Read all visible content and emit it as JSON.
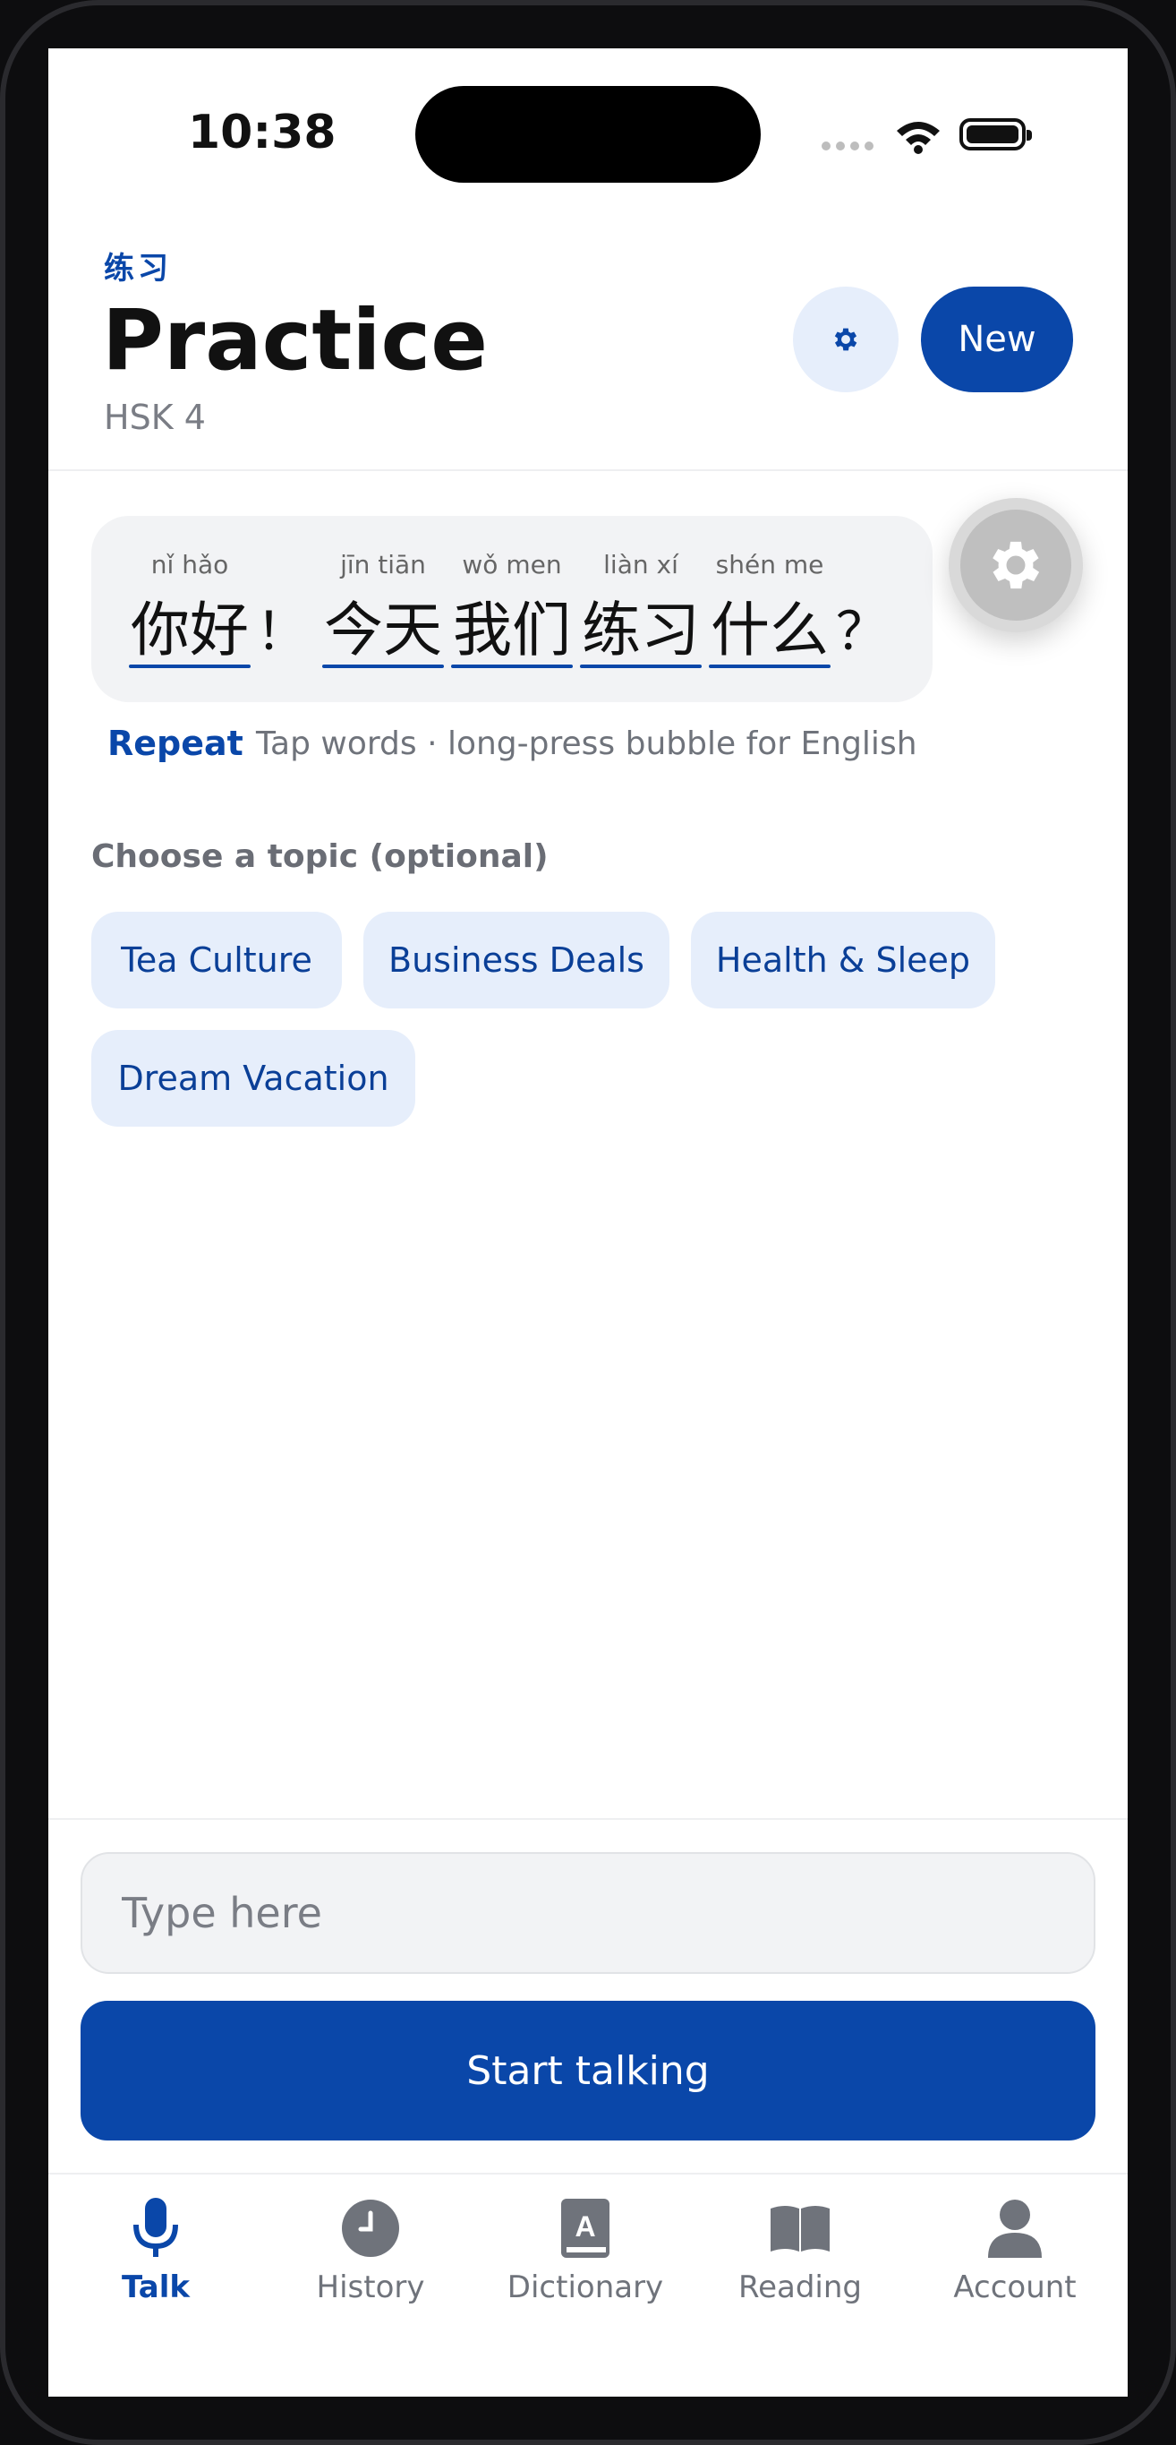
{
  "status_bar": {
    "time": "10:38"
  },
  "header": {
    "chinese_label": "练习",
    "title": "Practice",
    "level": "HSK 4",
    "new_button": "New"
  },
  "bubble": {
    "words": [
      {
        "pinyin": "nǐ hǎo",
        "hanzi": "你好",
        "punct": "！"
      },
      {
        "pinyin": "jīn tiān",
        "hanzi": "今天",
        "punct": ""
      },
      {
        "pinyin": "wǒ men",
        "hanzi": "我们",
        "punct": ""
      },
      {
        "pinyin": "liàn xí",
        "hanzi": "练习",
        "punct": ""
      },
      {
        "pinyin": "shén me",
        "hanzi": "什么",
        "punct": "？"
      }
    ]
  },
  "actions": {
    "repeat": "Repeat",
    "hint": "Tap words · long-press bubble for English"
  },
  "topics": {
    "heading": "Choose a topic (optional)",
    "items": [
      "Tea Culture",
      "Business Deals",
      "Health & Sleep",
      "Dream Vacation"
    ]
  },
  "input": {
    "placeholder": "Type here",
    "value": ""
  },
  "start_button": "Start talking",
  "nav": {
    "items": [
      {
        "label": "Talk",
        "icon": "mic-icon",
        "active": true
      },
      {
        "label": "History",
        "icon": "clock-icon",
        "active": false
      },
      {
        "label": "Dictionary",
        "icon": "dictionary-icon",
        "active": false
      },
      {
        "label": "Reading",
        "icon": "book-icon",
        "active": false
      },
      {
        "label": "Account",
        "icon": "person-icon",
        "active": false
      }
    ]
  },
  "colors": {
    "accent": "#0a47a9",
    "chip_bg": "#e6eefb",
    "bubble_bg": "#f2f3f5",
    "muted": "#6f737b"
  }
}
